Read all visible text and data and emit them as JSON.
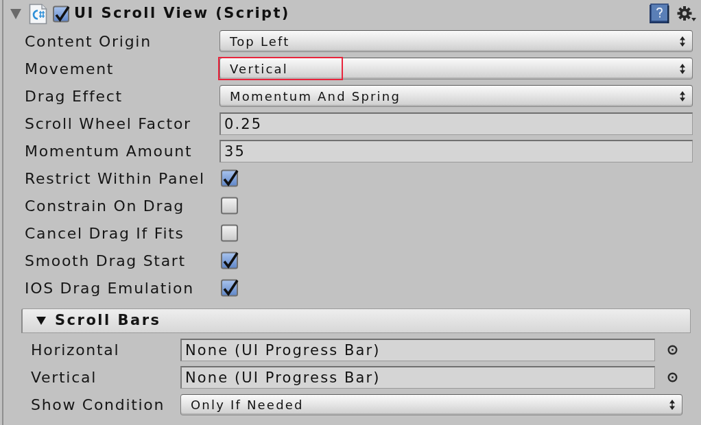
{
  "component": {
    "title": "UI Scroll View (Script)",
    "expanded": true,
    "enabled": true
  },
  "properties": [
    {
      "kind": "popup",
      "label": "Content Origin",
      "value": "Top Left",
      "highlighted": false
    },
    {
      "kind": "popup",
      "label": "Movement",
      "value": "Vertical",
      "highlighted": true
    },
    {
      "kind": "popup",
      "label": "Drag Effect",
      "value": "Momentum And Spring",
      "highlighted": false
    },
    {
      "kind": "number",
      "label": "Scroll Wheel Factor",
      "value": "0.25",
      "highlighted": false
    },
    {
      "kind": "number",
      "label": "Momentum Amount",
      "value": "35",
      "highlighted": false
    },
    {
      "kind": "toggle",
      "label": "Restrict Within Panel",
      "checked": true,
      "highlighted": false
    },
    {
      "kind": "toggle",
      "label": "Constrain On Drag",
      "checked": false,
      "highlighted": false
    },
    {
      "kind": "toggle",
      "label": "Cancel Drag If Fits",
      "checked": false,
      "highlighted": false
    },
    {
      "kind": "toggle",
      "label": "Smooth Drag Start",
      "checked": true,
      "highlighted": false
    },
    {
      "kind": "toggle",
      "label": "IOS Drag Emulation",
      "checked": true,
      "highlighted": false
    }
  ],
  "scroll_bars": {
    "title": "Scroll Bars",
    "expanded": true,
    "properties": [
      {
        "kind": "object",
        "label": "Horizontal",
        "value": "None (UI Progress Bar)"
      },
      {
        "kind": "object",
        "label": "Vertical",
        "value": "None (UI Progress Bar)"
      },
      {
        "kind": "popup",
        "label": "Show Condition",
        "value": "Only If Needed"
      }
    ]
  }
}
